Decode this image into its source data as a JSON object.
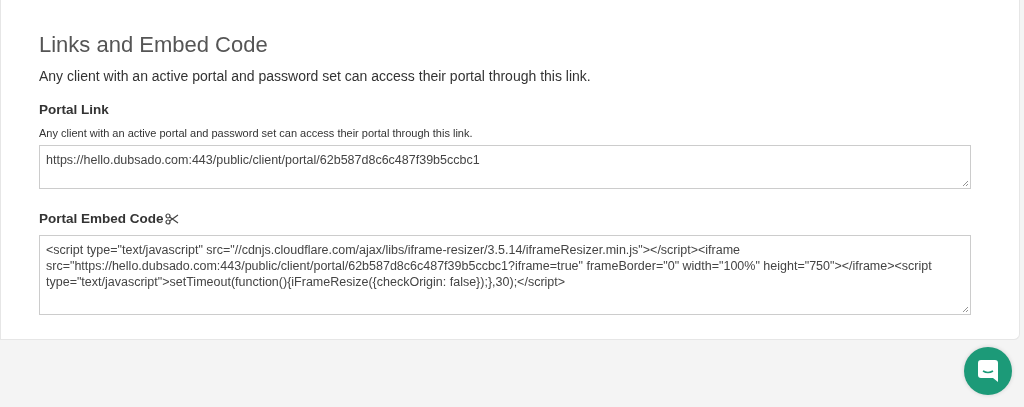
{
  "section": {
    "title": "Links and Embed Code",
    "description": "Any client with an active portal and password set can access their portal through this link."
  },
  "portal_link": {
    "label": "Portal Link",
    "help": "Any client with an active portal and password set can access their portal through this link.",
    "value": "https://hello.dubsado.com:443/public/client/portal/62b587d8c6c487f39b5ccbc1"
  },
  "embed_code": {
    "label": "Portal Embed Code",
    "value": "<script type=\"text/javascript\" src=\"//cdnjs.cloudflare.com/ajax/libs/iframe-resizer/3.5.14/iframeResizer.min.js\"></script><iframe src=\"https://hello.dubsado.com:443/public/client/portal/62b587d8c6c487f39b5ccbc1?iframe=true\" frameBorder=\"0\" width=\"100%\" height=\"750\"></iframe><script type=\"text/javascript\">setTimeout(function(){iFrameResize({checkOrigin: false});},30);</script>"
  }
}
